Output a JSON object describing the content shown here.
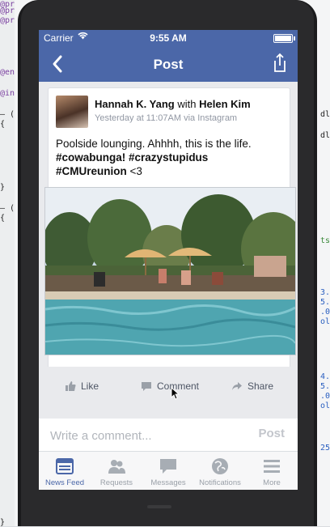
{
  "status_bar": {
    "carrier": "Carrier",
    "time": "9:55 AM"
  },
  "nav": {
    "title": "Post"
  },
  "post": {
    "author": "Hannah K. Yang",
    "with_word": "with",
    "tagged": "Helen Kim",
    "meta": "Yesterday at 11:07AM via Instagram",
    "text_line1": "Poolside lounging. Ahhhh, this is the life.",
    "hashtag1": "#cowabunga!",
    "hashtag2": "#crazystupidus",
    "hashtag3": "#CMUreunion",
    "text_tail": "<3"
  },
  "actions": {
    "like": "Like",
    "comment": "Comment",
    "share": "Share"
  },
  "composer": {
    "placeholder": "Write a comment...",
    "post": "Post"
  },
  "tabbar": {
    "items": [
      {
        "label": "News Feed",
        "icon": "news-feed-icon"
      },
      {
        "label": "Requests",
        "icon": "requests-icon"
      },
      {
        "label": "Messages",
        "icon": "messages-icon"
      },
      {
        "label": "Notifications",
        "icon": "notifications-icon"
      },
      {
        "label": "More",
        "icon": "more-icon"
      }
    ],
    "active_index": 0
  },
  "colors": {
    "brand": "#4b67a8",
    "card_bg": "#ffffff",
    "page_bg": "#e9eaed"
  }
}
